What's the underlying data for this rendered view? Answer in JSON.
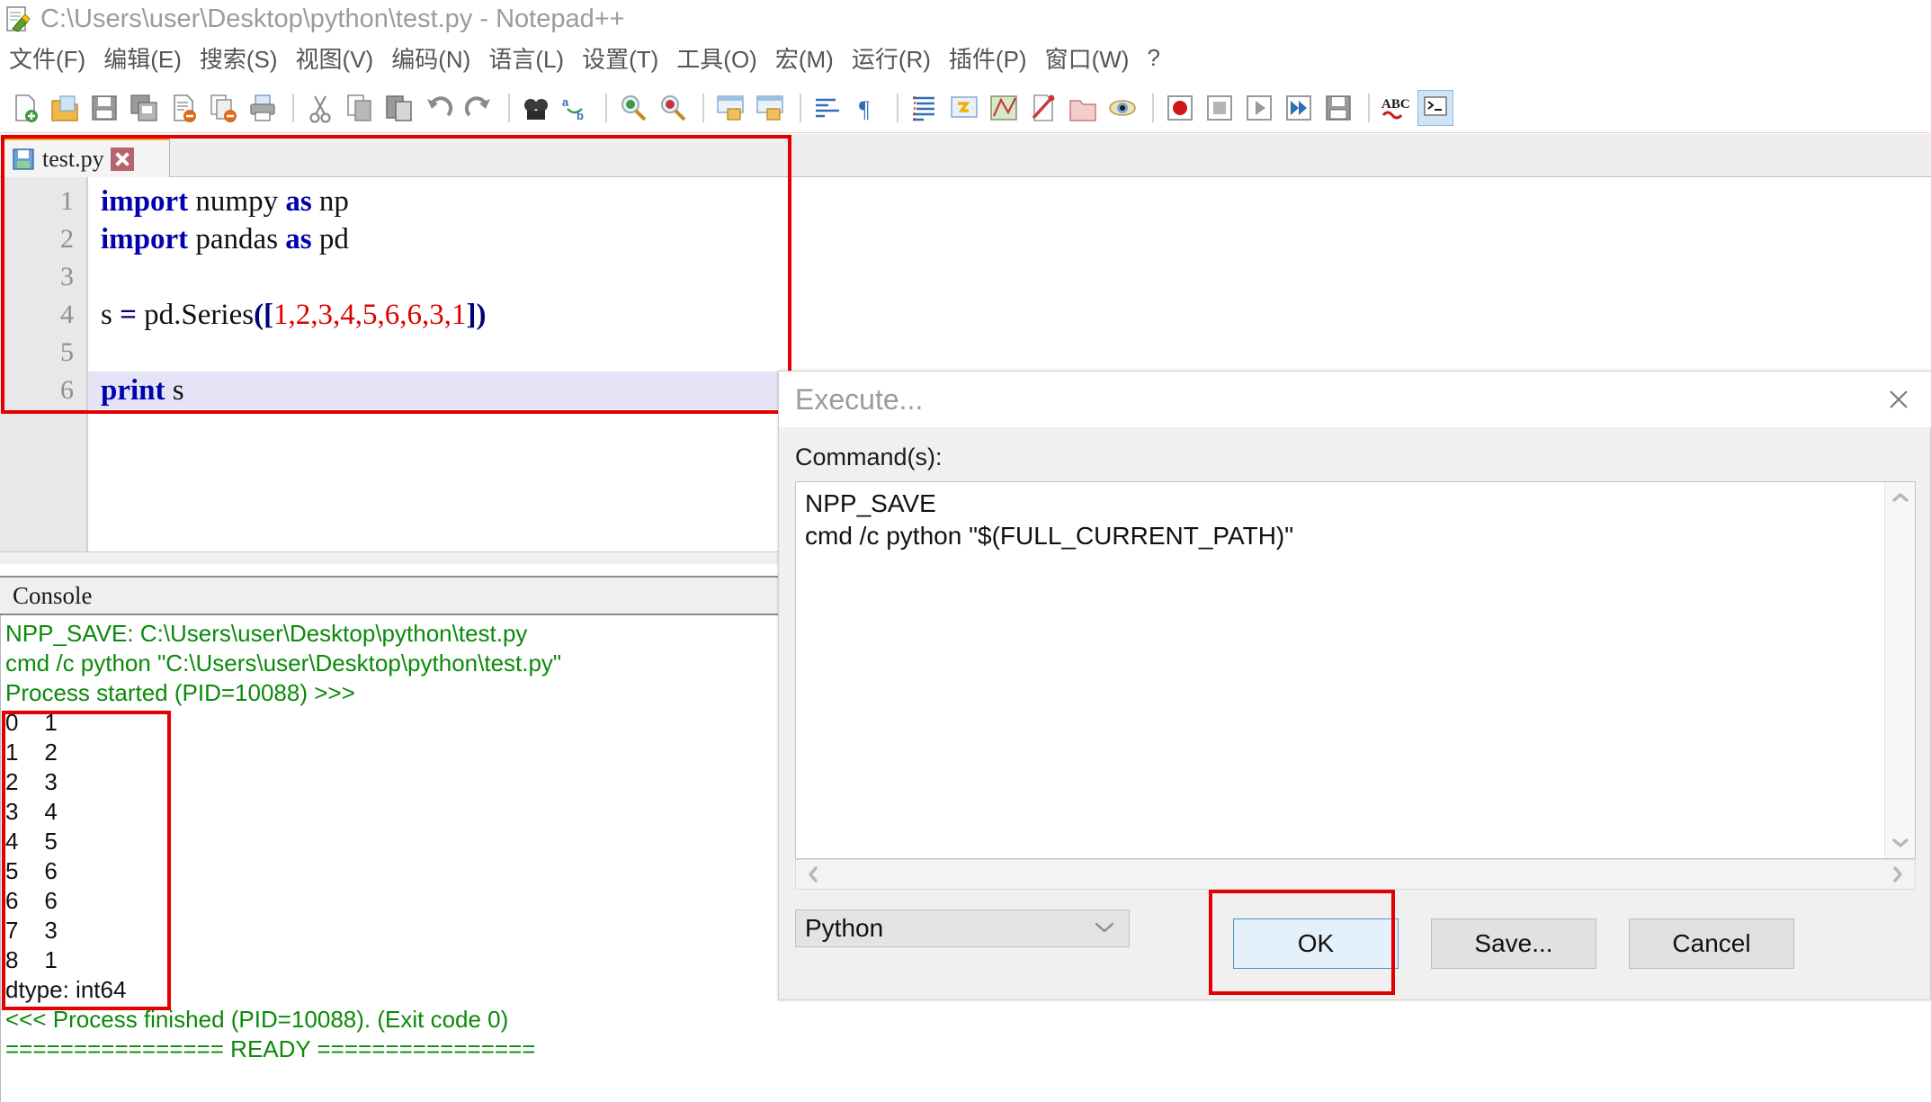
{
  "window": {
    "title": "C:\\Users\\user\\Desktop\\python\\test.py - Notepad++",
    "app_icon": "notepad-plus-plus-icon"
  },
  "menu": {
    "items": [
      {
        "label": "文件(F)",
        "name": "menu-file"
      },
      {
        "label": "编辑(E)",
        "name": "menu-edit"
      },
      {
        "label": "搜索(S)",
        "name": "menu-search"
      },
      {
        "label": "视图(V)",
        "name": "menu-view"
      },
      {
        "label": "编码(N)",
        "name": "menu-encoding"
      },
      {
        "label": "语言(L)",
        "name": "menu-language"
      },
      {
        "label": "设置(T)",
        "name": "menu-settings"
      },
      {
        "label": "工具(O)",
        "name": "menu-tools"
      },
      {
        "label": "宏(M)",
        "name": "menu-macro"
      },
      {
        "label": "运行(R)",
        "name": "menu-run"
      },
      {
        "label": "插件(P)",
        "name": "menu-plugins"
      },
      {
        "label": "窗口(W)",
        "name": "menu-window"
      },
      {
        "label": "?",
        "name": "menu-help"
      }
    ]
  },
  "toolbar": {
    "icons": [
      "new-file-icon",
      "open-file-icon",
      "save-icon",
      "save-all-icon",
      "close-file-icon",
      "close-all-icon",
      "print-icon",
      "cut-icon",
      "copy-icon",
      "paste-icon",
      "undo-icon",
      "redo-icon",
      "find-icon",
      "replace-icon",
      "zoom-in-icon",
      "zoom-out-icon",
      "sync-vertical-scroll-icon",
      "sync-horizontal-scroll-icon",
      "word-wrap-icon",
      "show-all-characters-icon",
      "indent-guide-icon",
      "user-defined-dialog-icon",
      "show-document-map-icon",
      "show-function-list-icon",
      "show-folder-as-workspace-icon",
      "monitoring-icon",
      "record-macro-icon",
      "stop-recording-icon",
      "play-macro-icon",
      "run-macro-multiple-icon",
      "save-macro-icon",
      "spell-check-icon",
      "console-toggle-icon"
    ]
  },
  "tab": {
    "label": "test.py",
    "save_icon": "floppy-save-icon",
    "close_icon": "close-tab-icon"
  },
  "editor": {
    "line_numbers": [
      "1",
      "2",
      "3",
      "4",
      "5",
      "6"
    ],
    "highlighted_line": 6,
    "lines": [
      {
        "n": 1,
        "tokens": [
          {
            "t": "import",
            "c": "kw"
          },
          {
            "t": " numpy ",
            "c": ""
          },
          {
            "t": "as",
            "c": "kw"
          },
          {
            "t": " np",
            "c": ""
          }
        ]
      },
      {
        "n": 2,
        "tokens": [
          {
            "t": "import",
            "c": "kw"
          },
          {
            "t": " pandas ",
            "c": ""
          },
          {
            "t": "as",
            "c": "kw"
          },
          {
            "t": " pd",
            "c": ""
          }
        ]
      },
      {
        "n": 3,
        "tokens": []
      },
      {
        "n": 4,
        "tokens": [
          {
            "t": "s ",
            "c": ""
          },
          {
            "t": "=",
            "c": "op"
          },
          {
            "t": " pd.Series",
            "c": ""
          },
          {
            "t": "([",
            "c": "brk"
          },
          {
            "t": "1,2,3,4,5,6,6,3,1",
            "c": "num"
          },
          {
            "t": "])",
            "c": "brk"
          }
        ]
      },
      {
        "n": 5,
        "tokens": []
      },
      {
        "n": 6,
        "tokens": [
          {
            "t": "print",
            "c": "kw"
          },
          {
            "t": " s",
            "c": ""
          }
        ]
      }
    ]
  },
  "console": {
    "title": "Console",
    "lines": [
      {
        "text": "NPP_SAVE: C:\\Users\\user\\Desktop\\python\\test.py",
        "color": "green"
      },
      {
        "text": "cmd /c python \"C:\\Users\\user\\Desktop\\python\\test.py\"",
        "color": "green"
      },
      {
        "text": "Process started (PID=10088) >>>",
        "color": "green"
      },
      {
        "text": "0    1",
        "color": "black"
      },
      {
        "text": "1    2",
        "color": "black"
      },
      {
        "text": "2    3",
        "color": "black"
      },
      {
        "text": "3    4",
        "color": "black"
      },
      {
        "text": "4    5",
        "color": "black"
      },
      {
        "text": "5    6",
        "color": "black"
      },
      {
        "text": "6    6",
        "color": "black"
      },
      {
        "text": "7    3",
        "color": "black"
      },
      {
        "text": "8    1",
        "color": "black"
      },
      {
        "text": "dtype: int64",
        "color": "black"
      },
      {
        "text": "<<< Process finished (PID=10088). (Exit code 0)",
        "color": "green"
      },
      {
        "text": "================ READY ================",
        "color": "green"
      }
    ]
  },
  "dialog": {
    "title": "Execute...",
    "close_icon": "close-icon",
    "commands_label": "Command(s):",
    "command_lines": [
      "NPP_SAVE",
      "cmd /c python \"$(FULL_CURRENT_PATH)\""
    ],
    "language_selected": "Python",
    "chevron_icon": "chevron-down-icon",
    "buttons": {
      "ok": "OK",
      "save": "Save...",
      "cancel": "Cancel"
    },
    "scroll": {
      "up_icon": "chevron-up-icon",
      "down_icon": "chevron-down-icon",
      "left_icon": "chevron-left-icon",
      "right_icon": "chevron-right-icon"
    }
  },
  "annotations": {
    "accent_color": "#e40000",
    "boxes": [
      "code-region-box",
      "series-output-box",
      "ok-button-box"
    ]
  }
}
